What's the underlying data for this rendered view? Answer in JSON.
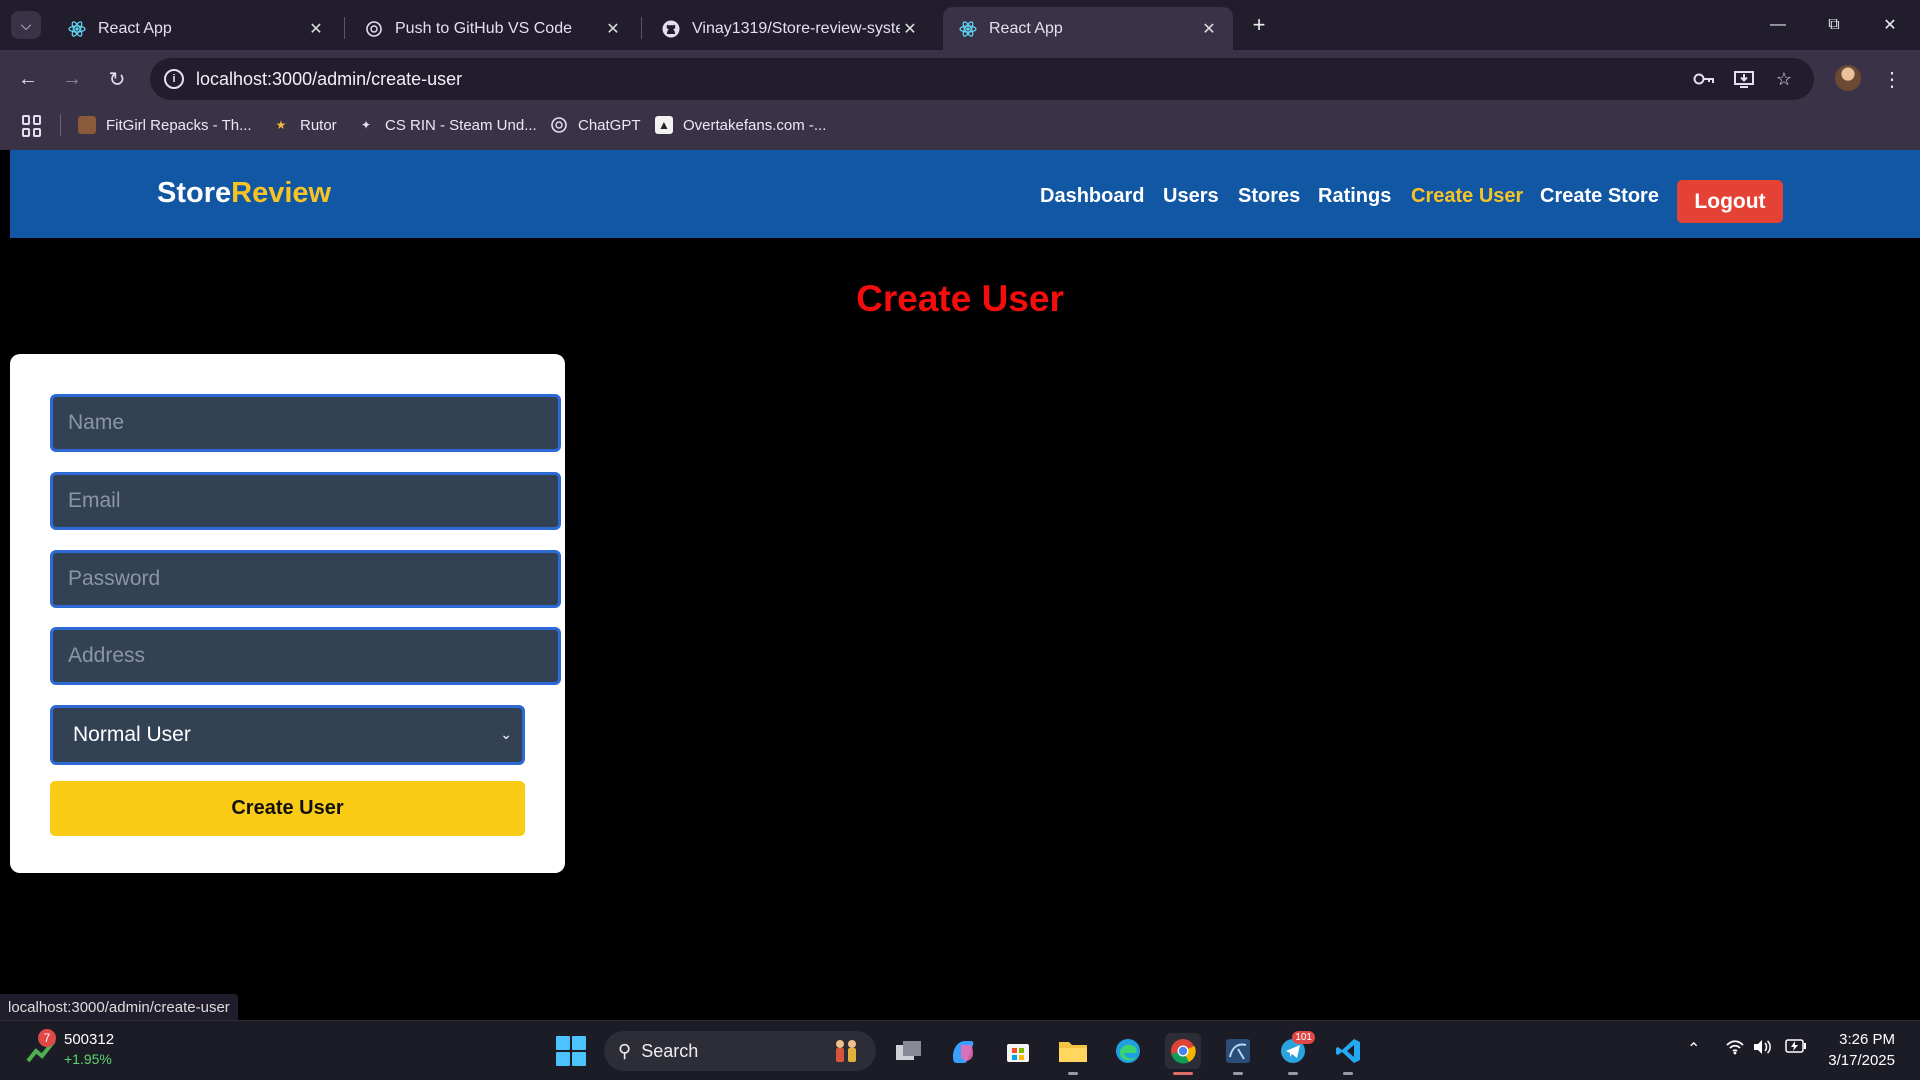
{
  "browser": {
    "tabs": [
      {
        "title": "React App",
        "active": false
      },
      {
        "title": "Push to GitHub VS Code",
        "active": false
      },
      {
        "title": "Vinay1319/Store-review-system",
        "active": false
      },
      {
        "title": "React App",
        "active": true
      }
    ],
    "url": "localhost:3000/admin/create-user",
    "bookmarks": [
      {
        "label": "FitGirl Repacks - Th..."
      },
      {
        "label": "Rutor"
      },
      {
        "label": "CS RIN - Steam Und..."
      },
      {
        "label": "ChatGPT"
      },
      {
        "label": "Overtakefans.com -..."
      }
    ],
    "status_url": "localhost:3000/admin/create-user"
  },
  "app": {
    "brand_main": "Store",
    "brand_accent": "Review",
    "nav": {
      "dashboard": "Dashboard",
      "users": "Users",
      "stores": "Stores",
      "ratings": "Ratings",
      "create_user": "Create User",
      "create_store": "Create Store"
    },
    "logout": "Logout",
    "page_title": "Create User",
    "form": {
      "name_placeholder": "Name",
      "email_placeholder": "Email",
      "password_placeholder": "Password",
      "address_placeholder": "Address",
      "role_selected": "Normal User",
      "submit_label": "Create User"
    },
    "colors": {
      "navbar": "#1257a4",
      "accent": "#f7c325",
      "title": "#f50d0d",
      "logout": "#e54236",
      "submit": "#facc15",
      "input_bg": "#334155",
      "input_border": "#2e6ad6"
    }
  },
  "taskbar": {
    "stock_badge": "7",
    "stock_value": "500312",
    "stock_change": "+1.95%",
    "search_label": "Search",
    "telegram_badge": "101",
    "time": "3:26 PM",
    "date": "3/17/2025"
  }
}
